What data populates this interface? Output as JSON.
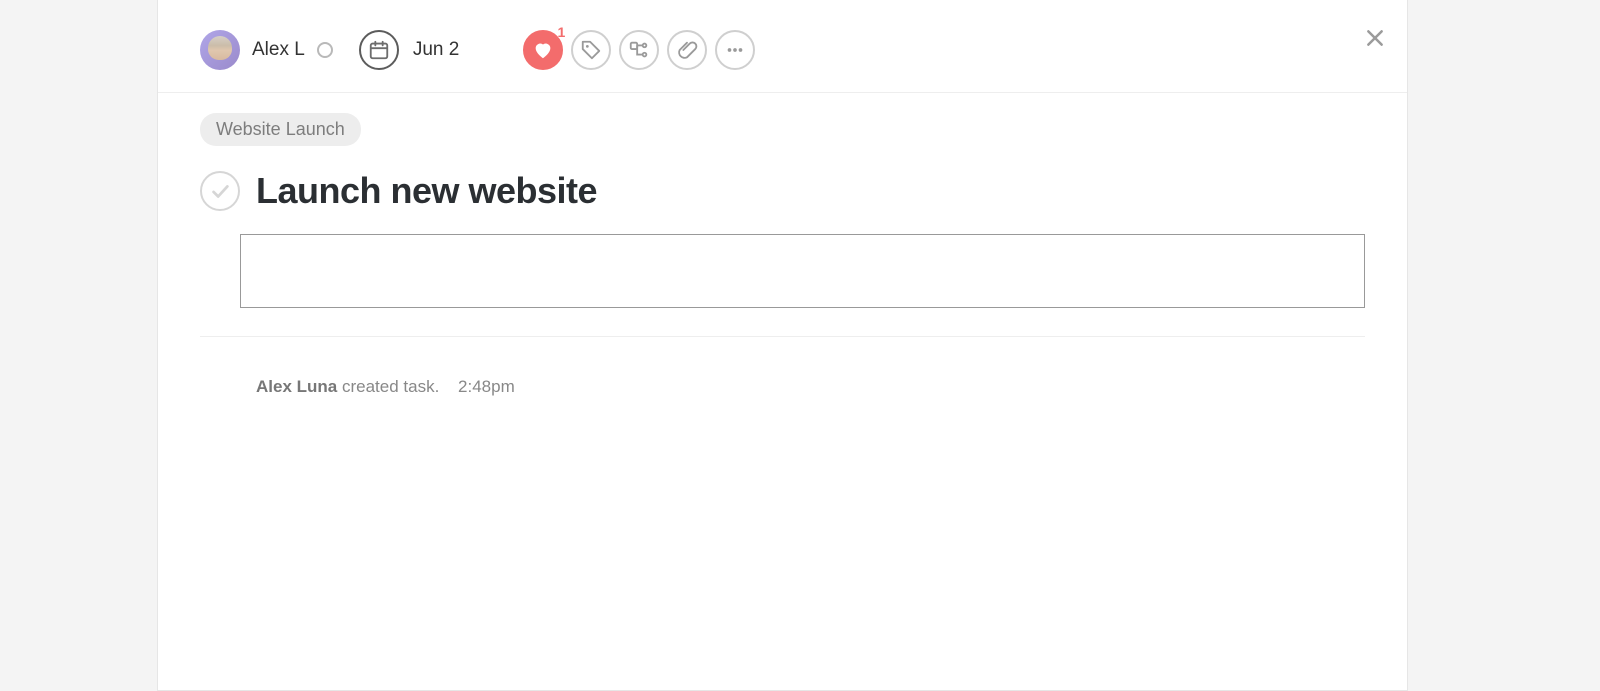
{
  "header": {
    "assignee_name": "Alex L",
    "due_date": "Jun 2",
    "like_count": "1"
  },
  "body": {
    "project_chip": "Website Launch",
    "task_title": "Launch new website",
    "description": ""
  },
  "activity": {
    "actor": "Alex Luna",
    "action": " created task.",
    "time": "2:48pm"
  }
}
